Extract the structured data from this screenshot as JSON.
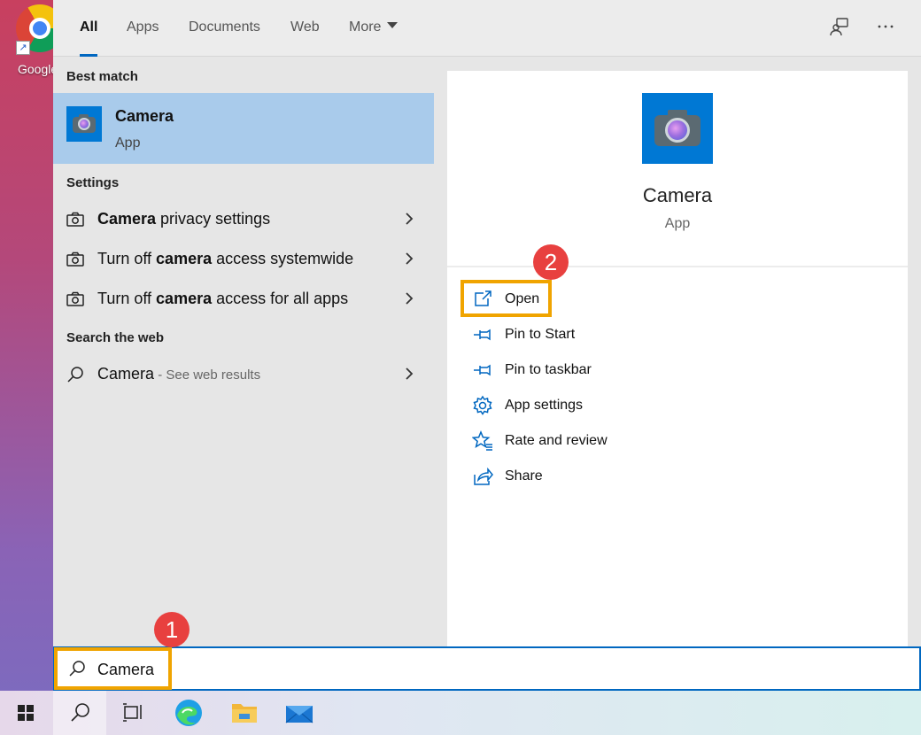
{
  "desktop": {
    "chrome_label": "Google Chrome"
  },
  "tabs": [
    {
      "label": "All"
    },
    {
      "label": "Apps"
    },
    {
      "label": "Documents"
    },
    {
      "label": "Web"
    },
    {
      "label": "More"
    }
  ],
  "sections": {
    "best_match": "Best match",
    "settings": "Settings",
    "search_web": "Search the web"
  },
  "best_match": {
    "title": "Camera",
    "subtitle": "App"
  },
  "settings_items": [
    {
      "bold": "Camera",
      "rest": " privacy settings"
    },
    {
      "pre": "Turn off ",
      "bold": "camera",
      "rest": " access systemwide"
    },
    {
      "pre": "Turn off ",
      "bold": "camera",
      "rest": " access for all apps"
    }
  ],
  "web_result": {
    "query": "Camera",
    "hint": " - See web results"
  },
  "detail": {
    "name": "Camera",
    "kind": "App",
    "actions": [
      {
        "label": "Open",
        "icon": "open-icon"
      },
      {
        "label": "Pin to Start",
        "icon": "pin-icon"
      },
      {
        "label": "Pin to taskbar",
        "icon": "pin-icon"
      },
      {
        "label": "App settings",
        "icon": "gear-icon"
      },
      {
        "label": "Rate and review",
        "icon": "star-icon"
      },
      {
        "label": "Share",
        "icon": "share-icon"
      }
    ]
  },
  "steps": [
    "1",
    "2"
  ],
  "search": {
    "value": "Camera"
  },
  "colors": {
    "accent": "#0067c0",
    "highlight": "#f0a400",
    "step": "#e8403f",
    "best_bg": "#a9cbeb"
  }
}
